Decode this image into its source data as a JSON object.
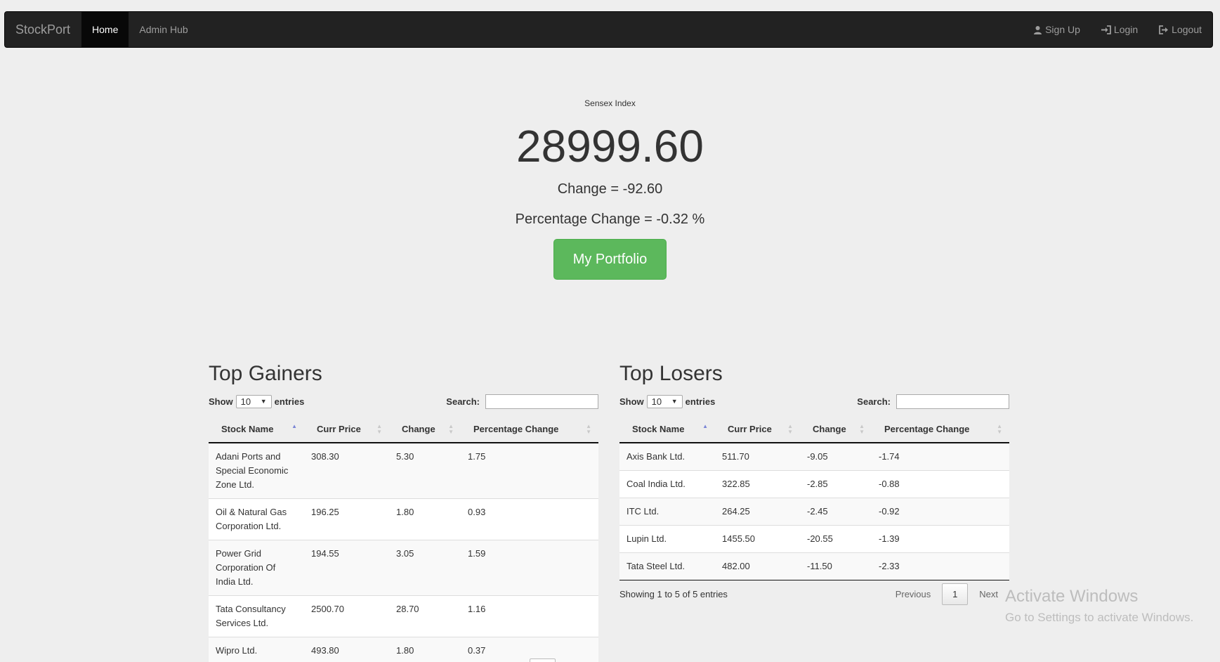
{
  "nav": {
    "brand": "StockPort",
    "items": [
      {
        "label": "Home",
        "active": true
      },
      {
        "label": "Admin Hub",
        "active": false
      }
    ],
    "right": [
      {
        "label": "Sign Up",
        "icon": "user-icon"
      },
      {
        "label": "Login",
        "icon": "login-icon"
      },
      {
        "label": "Logout",
        "icon": "logout-icon"
      }
    ]
  },
  "index": {
    "label": "Sensex Index",
    "value": "28999.60",
    "change": "Change = -92.60",
    "percentage": "Percentage Change = -0.32 %",
    "button": "My Portfolio"
  },
  "gainers": {
    "title": "Top Gainers",
    "show": "Show",
    "entries_value": "10",
    "entries": "entries",
    "search": "Search:",
    "columns": [
      "Stock Name",
      "Curr Price",
      "Change",
      "Percentage Change"
    ],
    "rows": [
      [
        "Adani Ports and Special Economic Zone Ltd.",
        "308.30",
        "5.30",
        "1.75"
      ],
      [
        "Oil & Natural Gas Corporation Ltd.",
        "196.25",
        "1.80",
        "0.93"
      ],
      [
        "Power Grid Corporation Of India Ltd.",
        "194.55",
        "3.05",
        "1.59"
      ],
      [
        "Tata Consultancy Services Ltd.",
        "2500.70",
        "28.70",
        "1.16"
      ],
      [
        "Wipro Ltd.",
        "493.80",
        "1.80",
        "0.37"
      ]
    ]
  },
  "losers": {
    "title": "Top Losers",
    "show": "Show",
    "entries_value": "10",
    "entries": "entries",
    "search": "Search:",
    "columns": [
      "Stock Name",
      "Curr Price",
      "Change",
      "Percentage Change"
    ],
    "rows": [
      [
        "Axis Bank Ltd.",
        "511.70",
        "-9.05",
        "-1.74"
      ],
      [
        "Coal India Ltd.",
        "322.85",
        "-2.85",
        "-0.88"
      ],
      [
        "ITC Ltd.",
        "264.25",
        "-2.45",
        "-0.92"
      ],
      [
        "Lupin Ltd.",
        "1455.50",
        "-20.55",
        "-1.39"
      ],
      [
        "Tata Steel Ltd.",
        "482.00",
        "-11.50",
        "-2.33"
      ]
    ],
    "info": "Showing 1 to 5 of 5 entries",
    "previous": "Previous",
    "page": "1",
    "next": "Next"
  },
  "watermark": {
    "line1": "Activate Windows",
    "line2": "Go to Settings to activate Windows."
  }
}
